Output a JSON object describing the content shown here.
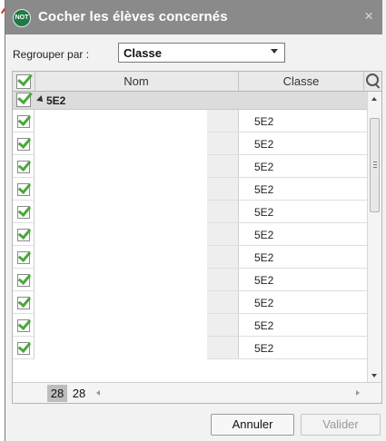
{
  "dialog": {
    "title": "Cocher les élèves concernés",
    "icon_text": "NOT",
    "close_label": "×"
  },
  "group_by": {
    "label": "Regrouper par :",
    "selected": "Classe"
  },
  "table": {
    "headers": {
      "nom": "Nom",
      "classe": "Classe"
    },
    "group": {
      "label": "5E2",
      "checked": true
    },
    "rows": [
      {
        "nom": "",
        "classe": "5E2",
        "checked": true
      },
      {
        "nom": "",
        "classe": "5E2",
        "checked": true
      },
      {
        "nom": "",
        "classe": "5E2",
        "checked": true
      },
      {
        "nom": "",
        "classe": "5E2",
        "checked": true
      },
      {
        "nom": "",
        "classe": "5E2",
        "checked": true
      },
      {
        "nom": "",
        "classe": "5E2",
        "checked": true
      },
      {
        "nom": "",
        "classe": "5E2",
        "checked": true
      },
      {
        "nom": "",
        "classe": "5E2",
        "checked": true
      },
      {
        "nom": "",
        "classe": "5E2",
        "checked": true
      },
      {
        "nom": "",
        "classe": "5E2",
        "checked": true
      },
      {
        "nom": "",
        "classe": "5E2",
        "checked": true
      }
    ]
  },
  "footer": {
    "selected_count": "28",
    "total_count": "28"
  },
  "buttons": {
    "cancel": "Annuler",
    "validate": "Valider"
  },
  "colors": {
    "titlebar": "#8a8a8a",
    "check": "#4aa83a",
    "icon_bg": "#1f7a45"
  }
}
